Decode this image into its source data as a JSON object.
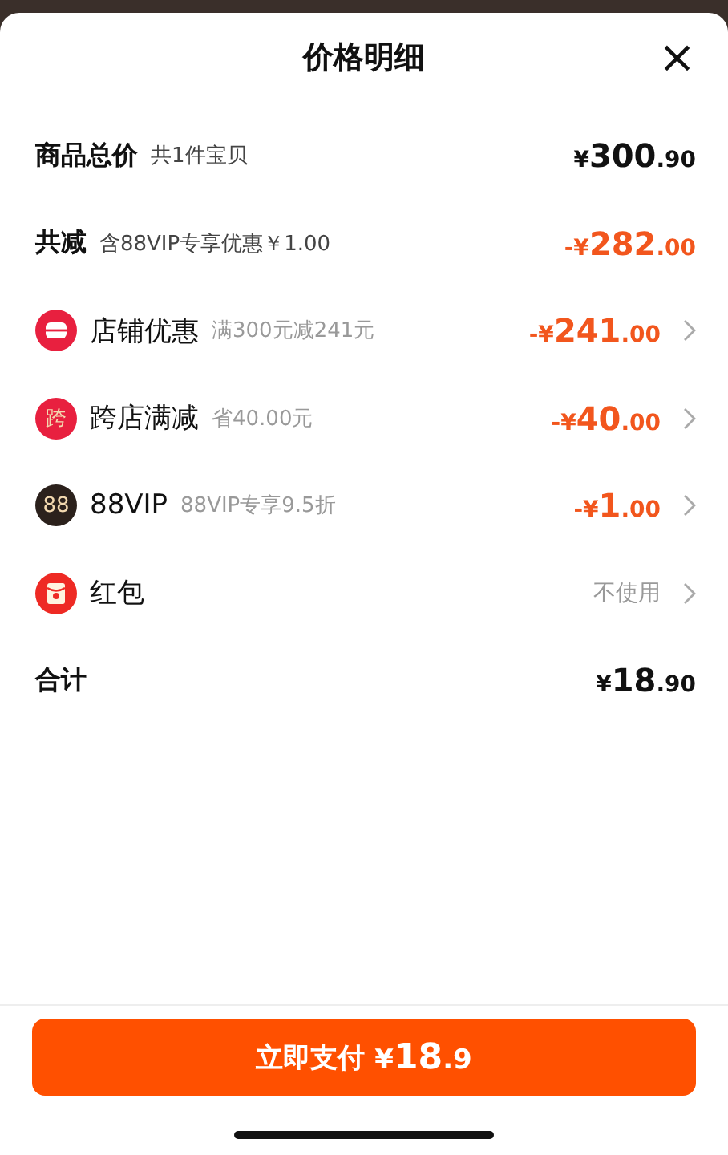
{
  "sheet": {
    "title": "价格明细",
    "close": "×"
  },
  "rows": [
    {
      "kind": "summary",
      "label": "商品总价",
      "note": "共1件宝贝",
      "value": {
        "kind": "price",
        "highlight": false,
        "prefix": "¥",
        "main": "300",
        "fraction": ".90"
      }
    },
    {
      "kind": "summary",
      "label": "共减",
      "note": "含88VIP专享优惠￥1.00",
      "value": {
        "kind": "price",
        "highlight": true,
        "prefix": "-¥",
        "main": "282",
        "fraction": ".00"
      }
    },
    {
      "kind": "detail",
      "icon": {
        "kind": "shop"
      },
      "label": "店铺优惠",
      "note": "满300元减241元",
      "value": {
        "kind": "price",
        "highlight": true,
        "prefix": "-¥",
        "main": "241",
        "fraction": ".00"
      }
    },
    {
      "kind": "detail",
      "icon": {
        "kind": "glyph",
        "text": "跨",
        "color": "#e8203f"
      },
      "label": "跨店满减",
      "note": "省40.00元",
      "value": {
        "kind": "price",
        "highlight": true,
        "prefix": "-¥",
        "main": "40",
        "fraction": ".00"
      }
    },
    {
      "kind": "detail",
      "icon": {
        "kind": "glyph",
        "text": "88",
        "color": "#2b211c"
      },
      "label": "88VIP",
      "note": "88VIP专享9.5折",
      "value": {
        "kind": "price",
        "highlight": true,
        "prefix": "-¥",
        "main": "1",
        "fraction": ".00"
      }
    },
    {
      "kind": "detail",
      "icon": {
        "kind": "packet"
      },
      "label": "红包",
      "value": {
        "kind": "text",
        "text": "不使用"
      }
    },
    {
      "kind": "summary",
      "label": "合计",
      "value": {
        "kind": "price",
        "highlight": false,
        "prefix": "¥",
        "main": "18",
        "fraction": ".90"
      }
    }
  ],
  "pay_button": {
    "label": "立即支付",
    "prefix": "¥",
    "main": "18",
    "fraction": ".9"
  }
}
